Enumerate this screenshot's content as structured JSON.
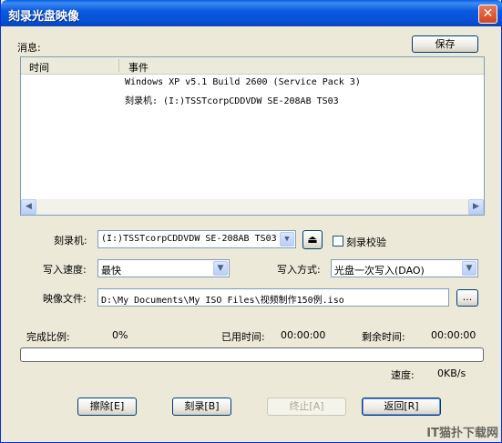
{
  "window": {
    "title": "刻录光盘映像",
    "close": "✕"
  },
  "messages": {
    "label": "消息:",
    "save_button": "保存",
    "columns": [
      "时间",
      "事件"
    ],
    "rows": [
      "Windows XP v5.1 Build 2600 (Service Pack 3)",
      "刻录机: (I:)TSSTcorpCDDVDW SE-208AB TS03"
    ]
  },
  "recorder": {
    "label": "刻录机:",
    "value": "(I:)TSSTcorpCDDVDW SE-208AB TS03",
    "verify_label": "刻录校验"
  },
  "write_speed": {
    "label": "写入速度:",
    "value": "最快"
  },
  "write_mode": {
    "label": "写入方式:",
    "value": "光盘一次写入(DAO)"
  },
  "image_file": {
    "label": "映像文件:",
    "value": "D:\\My Documents\\My ISO Files\\视频制作150例.iso",
    "browse": "..."
  },
  "progress": {
    "complete_label": "完成比例:",
    "complete_value": "0%",
    "elapsed_label": "已用时间:",
    "elapsed_value": "00:00:00",
    "remaining_label": "剩余时间:",
    "remaining_value": "00:00:00",
    "percent": 0,
    "speed_label": "速度:",
    "speed_value": "0KB/s"
  },
  "buttons": {
    "erase": "擦除[E]",
    "burn": "刻录[B]",
    "stop": "终止[A]",
    "back": "返回[R]"
  },
  "watermark": "IT猫扑下载网"
}
